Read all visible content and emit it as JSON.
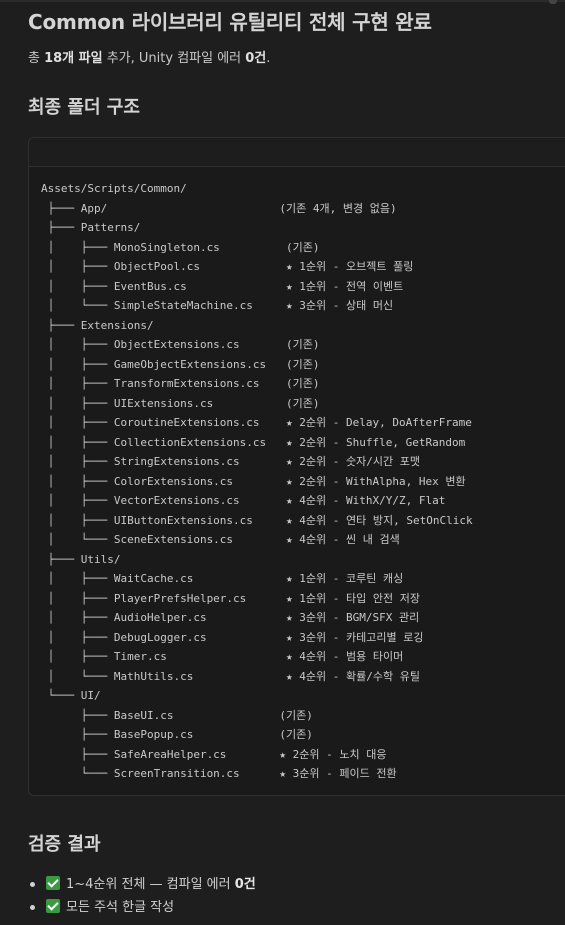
{
  "header": {
    "title": "Common 라이브러리 유틸리티 전체 구현 완료",
    "summary_prefix": "총 ",
    "summary_count": "18개 파일",
    "summary_mid": " 추가, Unity 컴파일 에러 ",
    "summary_errors": "0건",
    "summary_suffix": "."
  },
  "structure": {
    "heading": "최종 폴더 구조",
    "lines": [
      "Assets/Scripts/Common/",
      " ├─── App/                          (기존 4개, 변경 없음)",
      " ├─── Patterns/",
      " │    ├─── MonoSingleton.cs          (기존)",
      " │    ├─── ObjectPool.cs             ★ 1순위 - 오브젝트 풀링",
      " │    ├─── EventBus.cs               ★ 1순위 - 전역 이벤트",
      " │    └─── SimpleStateMachine.cs     ★ 3순위 - 상태 머신",
      " ├─── Extensions/",
      " │    ├─── ObjectExtensions.cs       (기존)",
      " │    ├─── GameObjectExtensions.cs   (기존)",
      " │    ├─── TransformExtensions.cs    (기존)",
      " │    ├─── UIExtensions.cs           (기존)",
      " │    ├─── CoroutineExtensions.cs    ★ 2순위 - Delay, DoAfterFrame",
      " │    ├─── CollectionExtensions.cs   ★ 2순위 - Shuffle, GetRandom",
      " │    ├─── StringExtensions.cs       ★ 2순위 - 숫자/시간 포맷",
      " │    ├─── ColorExtensions.cs        ★ 2순위 - WithAlpha, Hex 변환",
      " │    ├─── VectorExtensions.cs       ★ 4순위 - WithX/Y/Z, Flat",
      " │    ├─── UIButtonExtensions.cs     ★ 4순위 - 연타 방지, SetOnClick",
      " │    └─── SceneExtensions.cs        ★ 4순위 - 씬 내 검색",
      " ├─── Utils/",
      " │    ├─── WaitCache.cs              ★ 1순위 - 코루틴 캐싱",
      " │    ├─── PlayerPrefsHelper.cs      ★ 1순위 - 타입 안전 저장",
      " │    ├─── AudioHelper.cs            ★ 3순위 - BGM/SFX 관리",
      " │    ├─── DebugLogger.cs            ★ 3순위 - 카테고리별 로깅",
      " │    ├─── Timer.cs                  ★ 4순위 - 범용 타이머",
      " │    └─── MathUtils.cs              ★ 4순위 - 확률/수학 유틸",
      " └─── UI/",
      "      ├─── BaseUI.cs                (기존)",
      "      ├─── BasePopup.cs             (기존)",
      "      ├─── SafeAreaHelper.cs        ★ 2순위 - 노치 대응",
      "      └─── ScreenTransition.cs      ★ 3순위 - 페이드 전환"
    ]
  },
  "verification": {
    "heading": "검증 결과",
    "items": [
      {
        "prefix": "1~4순위 전체 — 컴파일 에러 ",
        "bold": "0건"
      },
      {
        "prefix": "모든 주석 한글 작성",
        "bold": ""
      }
    ]
  },
  "colors": {
    "background": "#1e1e1e",
    "check": "#3a9a42"
  }
}
